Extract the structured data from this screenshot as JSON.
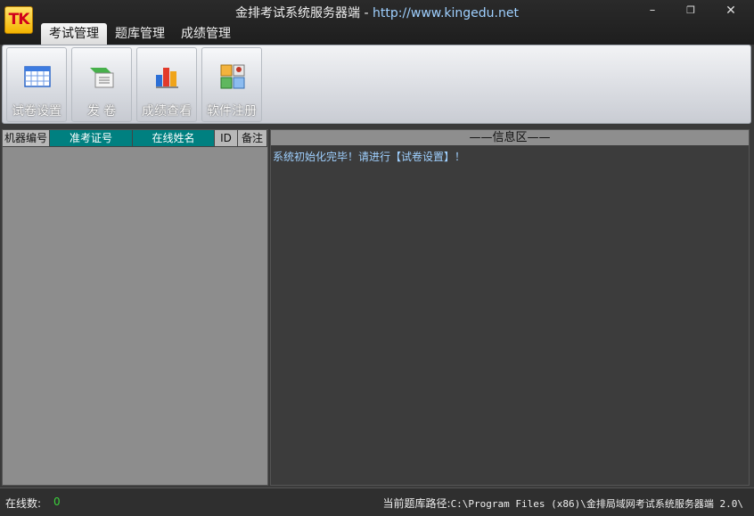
{
  "titlebar": {
    "logo_text": "TK",
    "title": "金排考试系统服务器端 - ",
    "url": "http://www.kingedu.net",
    "min_glyph": "–",
    "max_glyph": "❐",
    "close_glyph": "✕"
  },
  "menu": {
    "tabs": [
      {
        "label": "考试管理"
      },
      {
        "label": "题库管理"
      },
      {
        "label": "成绩管理"
      }
    ],
    "active_tab": "考试管理"
  },
  "toolbar": {
    "buttons": [
      {
        "label": "试卷设置",
        "icon": "table-grid-icon"
      },
      {
        "label": "发 卷",
        "icon": "distribute-paper-icon"
      },
      {
        "label": "成绩查看",
        "icon": "bar-chart-icon"
      },
      {
        "label": "软件注册",
        "icon": "register-app-icon"
      }
    ]
  },
  "grid": {
    "columns": [
      "机器编号",
      "准考证号",
      "在线姓名",
      "ID",
      "备注"
    ],
    "rows": []
  },
  "info": {
    "header": "——信息区——",
    "message": "系统初始化完毕！请进行【试卷设置】！"
  },
  "status": {
    "online_label": "在线数:",
    "online_count": "0",
    "path_label": "当前题库路径:",
    "path_value": "C:\\Program Files (x86)\\金排局域网考试系统服务器端 2.0\\"
  },
  "colors": {
    "accent_teal": "#008080",
    "info_text": "#9fd0ff",
    "online_count": "#3bd13b"
  }
}
